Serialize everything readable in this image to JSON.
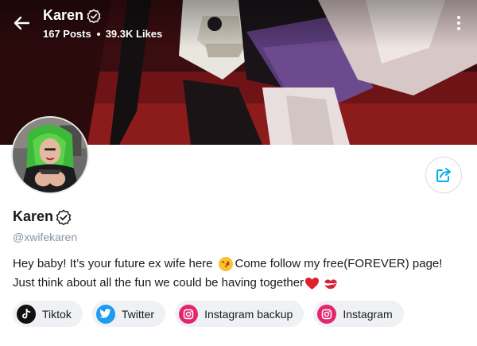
{
  "header": {
    "name": "Karen",
    "posts": "167 Posts",
    "likes": "39.3K Likes",
    "back_icon": "arrow-left-icon",
    "more_icon": "more-vertical-icon"
  },
  "profile": {
    "name": "Karen",
    "handle": "@xwifekaren",
    "verified_icon": "verified-badge-icon"
  },
  "bio": {
    "line1_before": "Hey baby! It’s your future ex wife here",
    "line1_after": "Come follow my free(FOREVER) page!",
    "line2": "Just think about all the fun we could be having together",
    "emojis": [
      "face-blowing-kiss",
      "red-heart",
      "kiss-mark"
    ]
  },
  "links": [
    {
      "label": "Tiktok",
      "icon": "tiktok-icon"
    },
    {
      "label": "Twitter",
      "icon": "twitter-icon"
    },
    {
      "label": "Instagram backup",
      "icon": "instagram-icon"
    },
    {
      "label": "Instagram",
      "icon": "instagram-icon"
    }
  ],
  "actions": {
    "share_icon": "share-icon"
  },
  "colors": {
    "accent": "#00aff0",
    "handle": "#8a96a3",
    "chip_bg": "#f0f1f4",
    "instagram": "#e4266f",
    "twitter": "#1d9bf0",
    "emoji_heart": "#e0202e"
  }
}
